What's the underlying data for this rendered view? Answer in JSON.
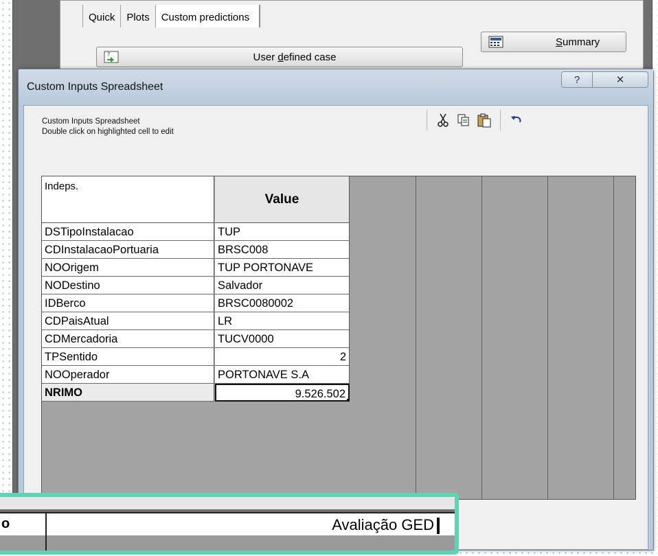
{
  "background": {
    "tabs": [
      "Quick",
      "Plots",
      "Custom predictions"
    ],
    "summary_button": {
      "prefix": "",
      "mnemonic": "S",
      "rest": "ummary"
    },
    "user_defined_button": {
      "prefix": "User ",
      "mnemonic": "d",
      "rest": "efined case"
    }
  },
  "dialog": {
    "title": "Custom Inputs Spreadsheet",
    "help_glyph": "?",
    "close_glyph": "✕",
    "header_line1": "Custom Inputs Spreadsheet",
    "header_line2": "Double click on highlighted cell to edit",
    "toolbar_icons": [
      "cut-icon",
      "copy-icon",
      "paste-icon",
      "undo-icon"
    ]
  },
  "grid": {
    "index_header": "Indeps.",
    "value_header": "Value",
    "rows": [
      {
        "name": "DSTipoInstalacao",
        "value": "TUP"
      },
      {
        "name": "CDInstalacaoPortuaria",
        "value": "BRSC008"
      },
      {
        "name": "NOOrigem",
        "value": "TUP PORTONAVE"
      },
      {
        "name": "NODestino",
        "value": "Salvador"
      },
      {
        "name": "IDBerco",
        "value": "BRSC0080002"
      },
      {
        "name": "CDPaisAtual",
        "value": "LR"
      },
      {
        "name": "CDMercadoria",
        "value": "TUCV0000"
      },
      {
        "name": "TPSentido",
        "value": "2"
      },
      {
        "name": "NOOperador",
        "value": "PORTONAVE S.A"
      },
      {
        "name": "NRIMO",
        "value": "9.526.502"
      }
    ]
  },
  "overlay": {
    "label": "o",
    "value": "Avaliação GED"
  },
  "colors": {
    "dialog_frame": "#b8c9da",
    "grid_empty": "#a3a3a3",
    "overlay_border": "#5fd3b4"
  }
}
